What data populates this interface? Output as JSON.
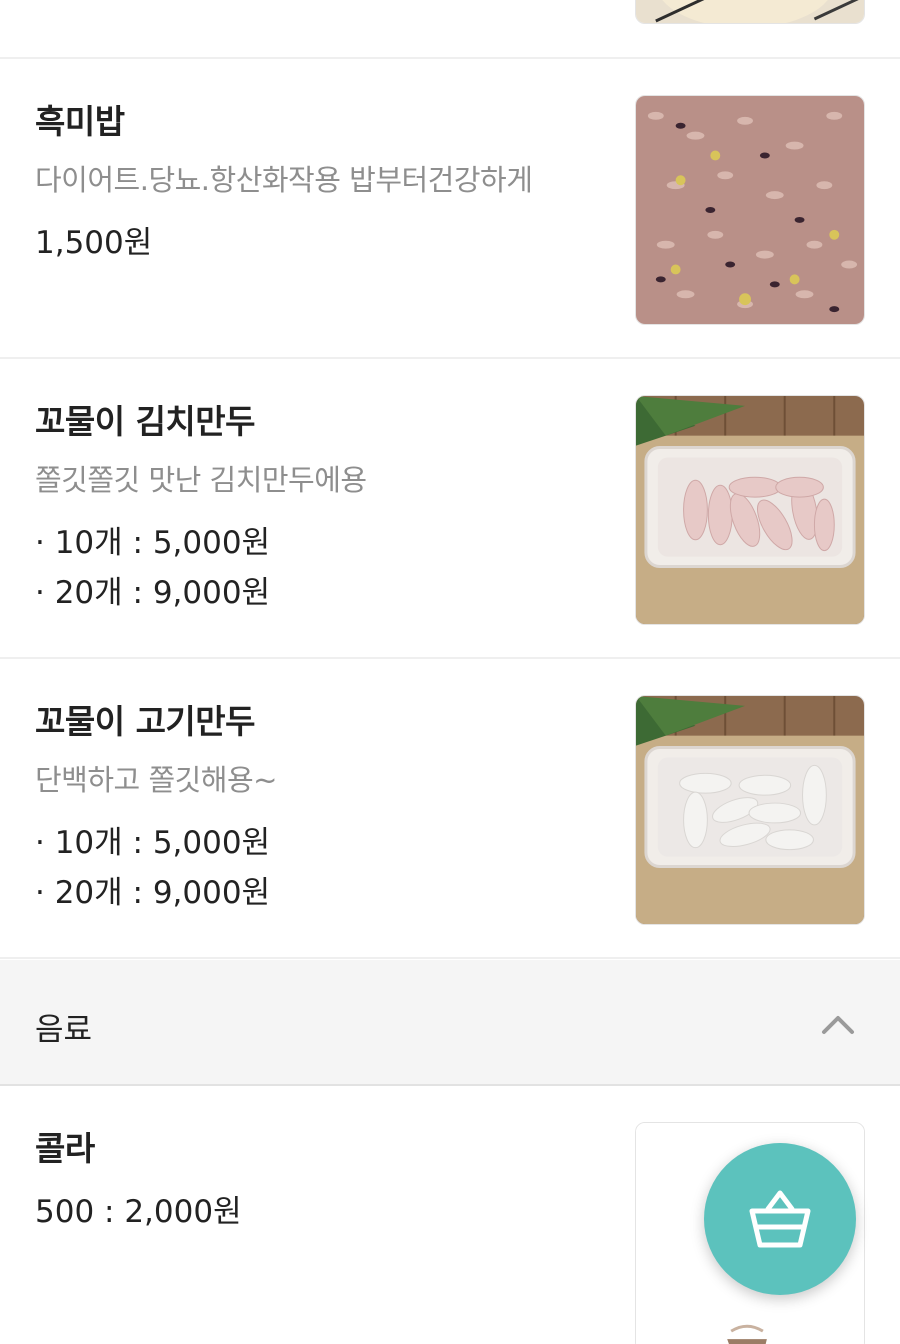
{
  "menu": {
    "items": [
      {
        "name": "흑미밥",
        "description": "다이어트.당뇨.항산화작용 밥부터건강하게",
        "price": "1,500원"
      },
      {
        "name": "꼬물이 김치만두",
        "description": "쫄깃쫄깃 맛난 김치만두에용",
        "prices": [
          "· 10개 : 5,000원",
          "· 20개 : 9,000원"
        ]
      },
      {
        "name": "꼬물이 고기만두",
        "description": "단백하고 쫄깃해용~",
        "prices": [
          "· 10개 : 5,000원",
          "· 20개 : 9,000원"
        ]
      }
    ]
  },
  "section": {
    "title": "음료",
    "toggle_icon": "chevron-up-icon",
    "items": [
      {
        "name": "콜라",
        "price": "500 : 2,000원"
      }
    ]
  },
  "cart_button": {
    "icon": "basket-icon",
    "color": "#5cc2bd"
  }
}
